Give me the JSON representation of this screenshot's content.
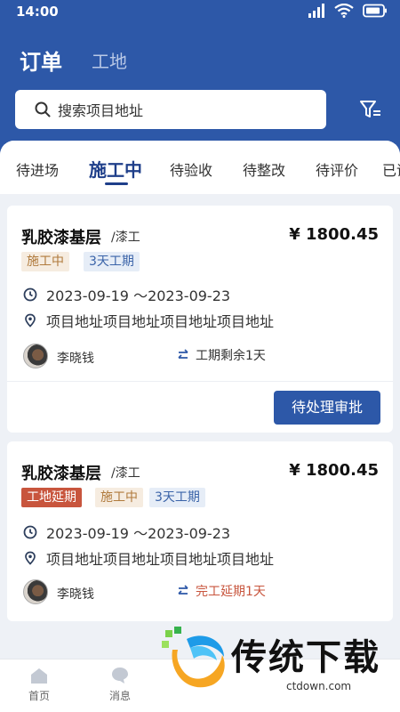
{
  "status_bar": {
    "time": "14:00"
  },
  "header": {
    "tabs": [
      {
        "label": "订单",
        "active": true
      },
      {
        "label": "工地",
        "active": false
      }
    ],
    "search": {
      "placeholder": "搜索项目地址",
      "icon": "search-icon"
    },
    "filter": {
      "icon": "filter-icon"
    }
  },
  "status_tabs": [
    {
      "label": "待进场",
      "active": false
    },
    {
      "label": "施工中",
      "active": true
    },
    {
      "label": "待验收",
      "active": false
    },
    {
      "label": "待整改",
      "active": false
    },
    {
      "label": "待评价",
      "active": false
    },
    {
      "label": "已评",
      "active": false
    }
  ],
  "orders": [
    {
      "title": "乳胶漆基层",
      "subtitle": "/漆工",
      "price": "¥ 1800.45",
      "tags": [
        "施工中",
        "3天工期"
      ],
      "date_range": "2023-09-19 ～2023-09-23",
      "address": "项目地址项目地址项目地址项目地址",
      "person": "李晓钱",
      "period_info": "工期剩余1天",
      "action_label": "待处理审批"
    },
    {
      "title": "乳胶漆基层",
      "subtitle": "/漆工",
      "price": "¥ 1800.45",
      "tags": [
        "工地延期",
        "施工中",
        "3天工期"
      ],
      "date_range": "2023-09-19 ～2023-09-23",
      "address": "项目地址项目地址项目地址项目地址",
      "person": "李晓钱",
      "period_info": "完工延期1天"
    }
  ],
  "bottom_nav": [
    {
      "label": "首页",
      "icon": "home-icon"
    },
    {
      "label": "消息",
      "icon": "message-icon"
    }
  ],
  "watermark": {
    "brand": "传统下载",
    "url": "ctdown.com"
  },
  "colors": {
    "primary": "#2d58a8",
    "delay": "#c8553d",
    "background": "#eef1f6"
  }
}
